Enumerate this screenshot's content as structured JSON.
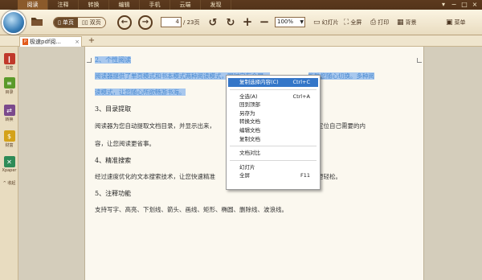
{
  "menu": {
    "tabs": [
      "阅读",
      "注释",
      "转换",
      "编辑",
      "手机",
      "云端",
      "发现"
    ],
    "active_index": 0
  },
  "toolbar": {
    "view_single": "单页",
    "view_double": "双页",
    "current_page": "4",
    "total_pages": "/ 23页",
    "zoom": "100%",
    "slideshow": "幻灯片",
    "fullscreen": "全屏",
    "print": "打印",
    "background": "背景",
    "menu": "菜单"
  },
  "tabbar": {
    "doc_title": "极速pdf阅...",
    "close": "×",
    "new_tab": "+"
  },
  "sidebar": {
    "items": [
      {
        "label": "书签",
        "icon": "bookmark-icon",
        "color": "#c0392b"
      },
      {
        "label": "目录",
        "icon": "toc-icon",
        "color": "#5a9a2a"
      },
      {
        "label": "转换",
        "icon": "convert-icon",
        "color": "#7b4a8c"
      },
      {
        "label": "财富",
        "icon": "money-icon",
        "color": "#d4a21a"
      },
      {
        "label": "Xpaper",
        "icon": "xpaper-icon",
        "color": "#2e8b57"
      },
      {
        "label": "^ 收起",
        "icon": "collapse-icon",
        "color": "#8b6a45"
      }
    ]
  },
  "document": {
    "sec2_heading": "2、个性阅读",
    "sec2_line1_pre": "阅读器提供了单页模式和书本模式两种阅读模式，同时它有全屏、",
    "sec2_line1_post": "能助您随心切换。多种阅",
    "sec2_line2": "读模式，让您随心所欲畅游书海。",
    "sec3_heading": "3、目录提取",
    "sec3_line1_pre": "阅读器为您自动提取文档目录，并显示出来，",
    "sec3_line1_post": "快速定位自己需要的内",
    "sec3_line2": "容，让您阅读更省事。",
    "sec4_heading": "4、精准搜索",
    "sec4_line1_pre": "经过速度优化的文本搜索技术，让您快速精准",
    "sec4_line1_post": "搜索更轻松。",
    "sec5_heading": "5、注释功能",
    "sec5_line1": "支持写字、高亮、下划线、箭头、画线、矩形、椭圆、删除线、波浪线。"
  },
  "context_menu": {
    "copy_selection": "复制选择内容(C)",
    "copy_selection_key": "Ctrl+C",
    "select_all": "全选(A)",
    "select_all_key": "Ctrl+A",
    "back_to_top": "回到顶部",
    "save_as": "另存为",
    "convert_doc": "转换文档",
    "edit_doc": "编辑文档",
    "copy_doc": "复制文档",
    "compare_doc": "文档对比",
    "slideshow": "幻灯片",
    "fullscreen": "全屏",
    "fullscreen_key": "F11"
  },
  "colors": {
    "topbar": "#4a2d15",
    "selection": "#a8c8ee",
    "menu_highlight": "#3476c8"
  }
}
